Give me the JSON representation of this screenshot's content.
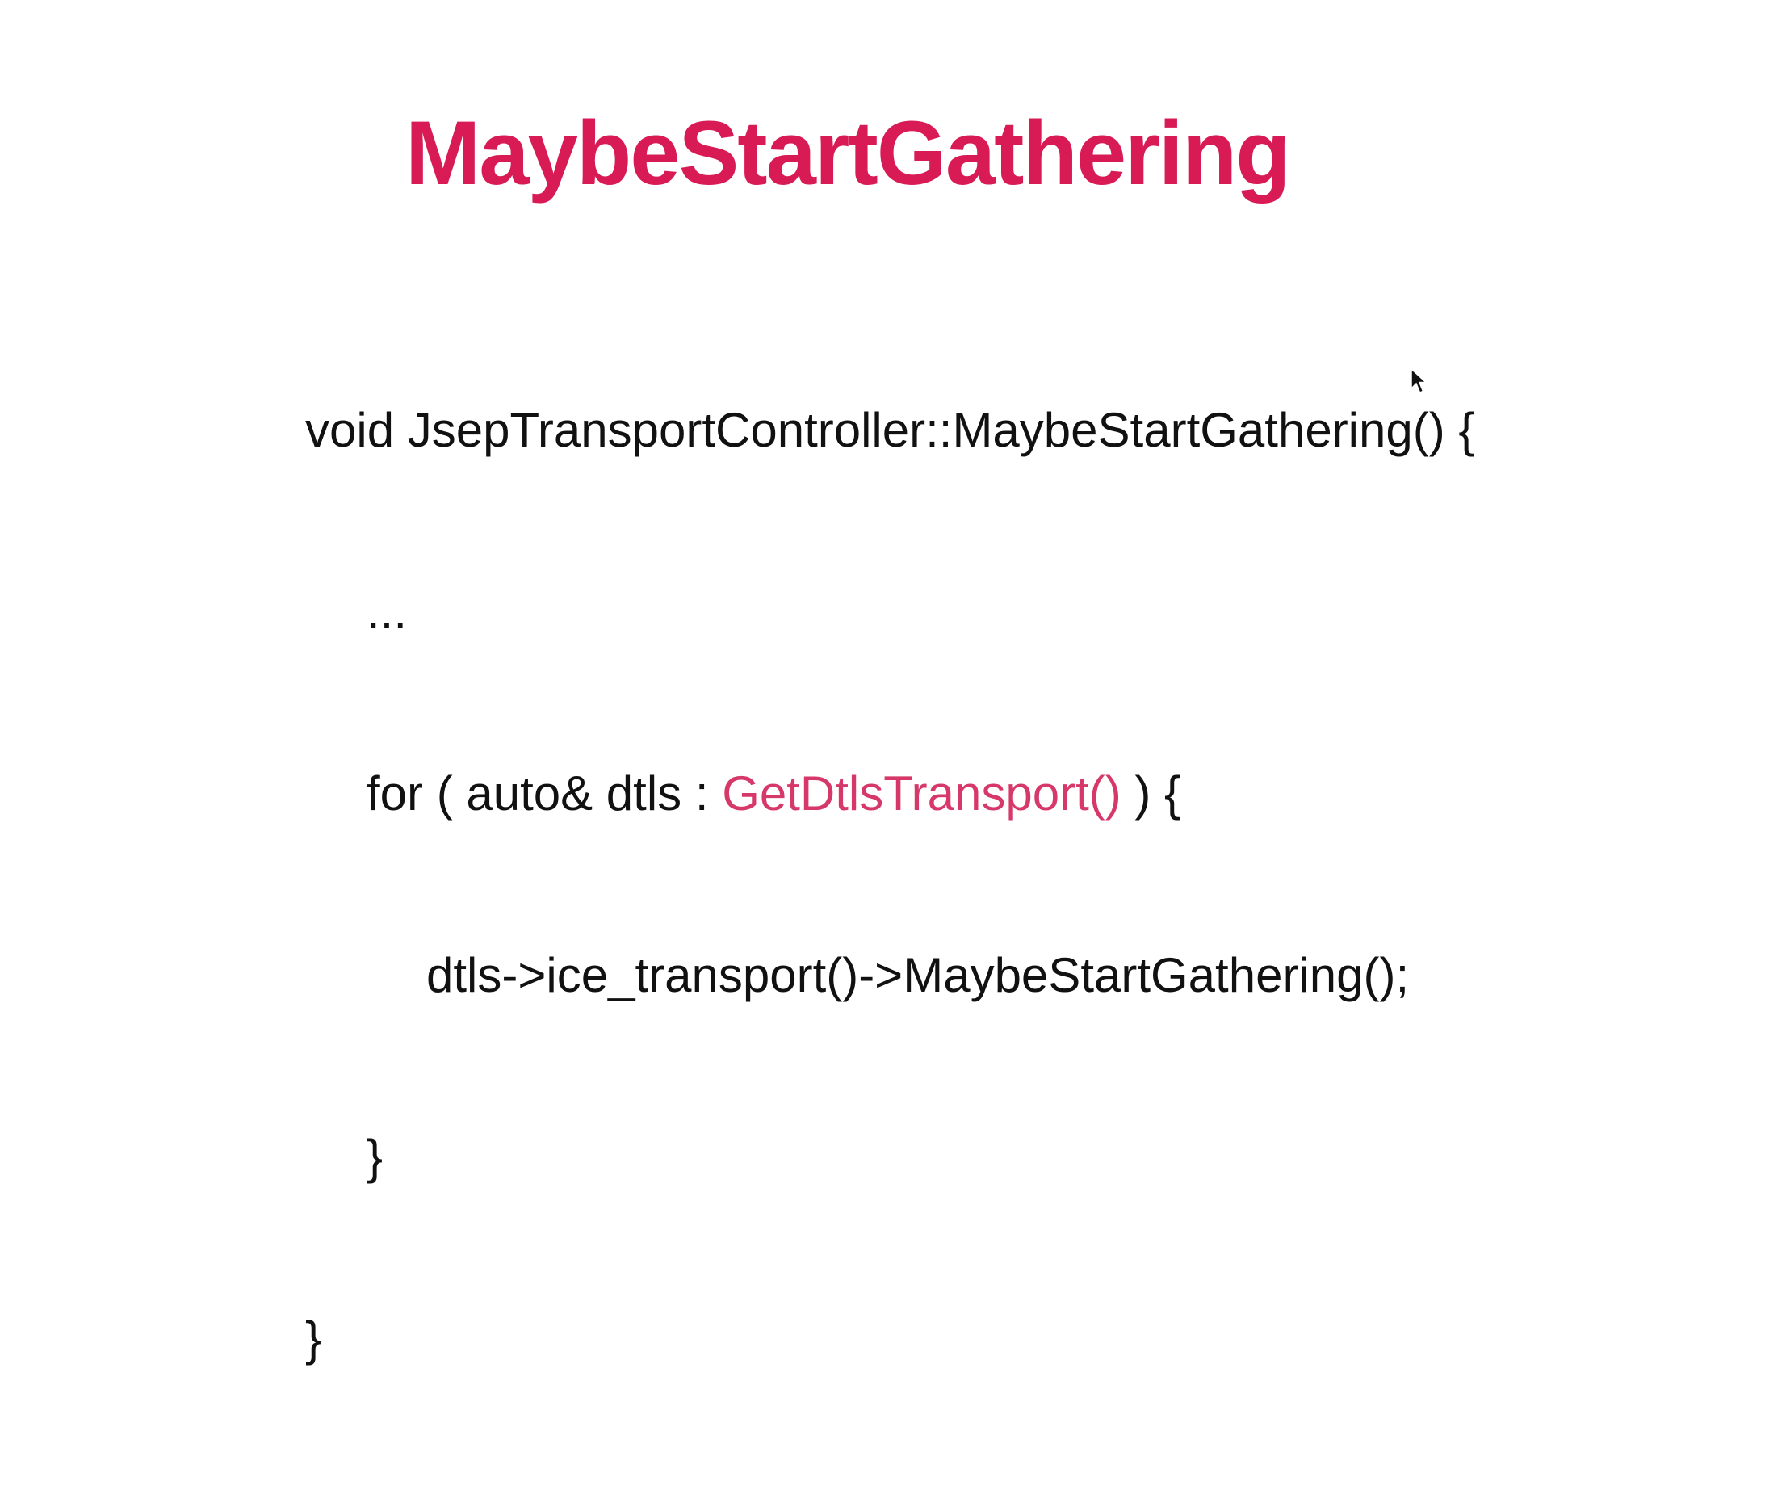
{
  "slide": {
    "title": "MaybeStartGathering",
    "accent_color": "#d81b55",
    "code": {
      "line1": "void JsepTransportController::MaybeStartGathering() {",
      "line2": "...",
      "line3_before": "for ( auto& dtls : ",
      "line3_highlight": "GetDtlsTransport()",
      "line3_after": " ) {",
      "line4": "dtls->ice_transport()->MaybeStartGathering();",
      "line5": "}",
      "line6": "}"
    },
    "cursor_icon": "mouse-pointer-icon"
  }
}
